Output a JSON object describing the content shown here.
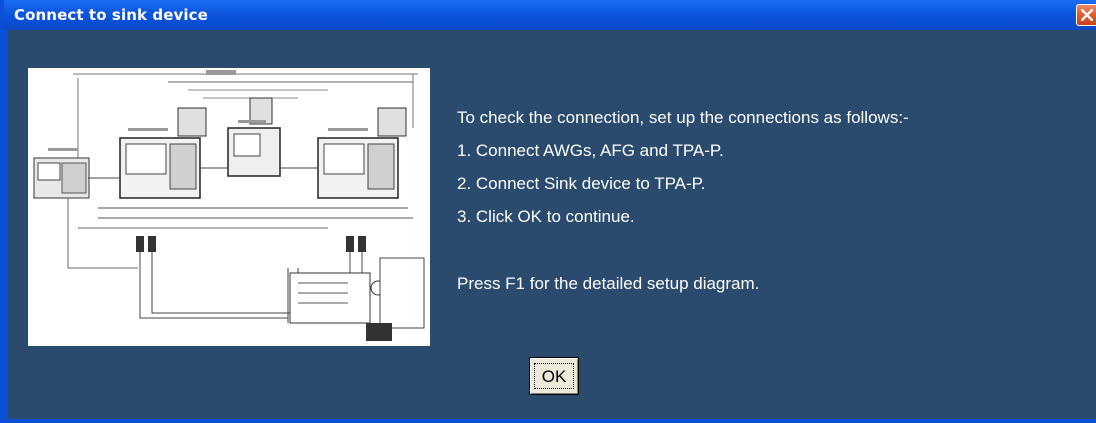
{
  "window": {
    "title": "Connect to sink device"
  },
  "instructions": {
    "intro": "To check the connection, set up the connections as follows:-",
    "step1": "1. Connect AWGs, AFG and TPA-P.",
    "step2": "2. Connect Sink device to TPA-P.",
    "step3": "3. Click OK to continue.",
    "help": "Press F1 for the detailed setup diagram."
  },
  "buttons": {
    "ok_label": "OK"
  },
  "icons": {
    "close": "close-icon",
    "diagram": "setup-diagram-image"
  },
  "colors": {
    "title_bar": "#0a50d8",
    "panel_background": "#2a4a6e",
    "close_button": "#e35a30",
    "button_face": "#ece9d8"
  }
}
